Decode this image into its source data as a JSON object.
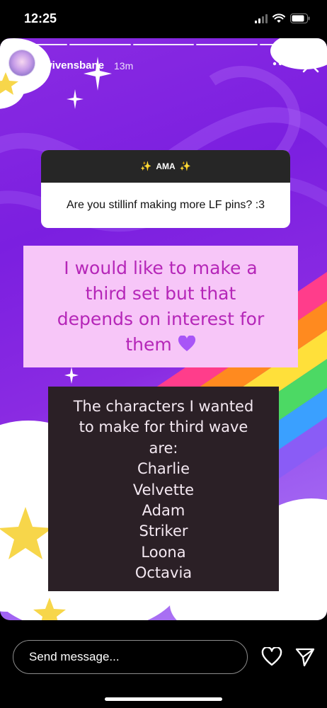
{
  "status_bar": {
    "time": "12:25"
  },
  "story": {
    "username": "wivensbane",
    "time_ago": "13m",
    "question_sticker": {
      "title": "AMA",
      "sparkle": "✨",
      "question": "Are you stillinf making more LF pins? :3"
    },
    "answer_lines": [
      "I would like to make a",
      "third set but that",
      "depends on interest for",
      "them"
    ],
    "answer_emoji": "💜",
    "list_lines": [
      "The characters I wanted",
      "to make for third wave",
      "are:",
      "Charlie",
      "Velvette",
      "Adam",
      "Striker",
      "Loona",
      "Octavia"
    ]
  },
  "composer": {
    "placeholder": "Send message..."
  },
  "icons": {
    "more": "more-horizontal-icon",
    "close": "close-icon",
    "like": "heart-icon",
    "send": "send-icon",
    "wifi": "wifi-icon",
    "battery": "battery-icon",
    "signal": "signal-icon"
  },
  "colors": {
    "story_purple": "#8a2be2",
    "answer_bg": "#f7c6f8",
    "answer_text": "#b526b8",
    "list_bg": "#2b2026",
    "list_text": "#f4e9f2",
    "sticker_header": "#262626"
  }
}
